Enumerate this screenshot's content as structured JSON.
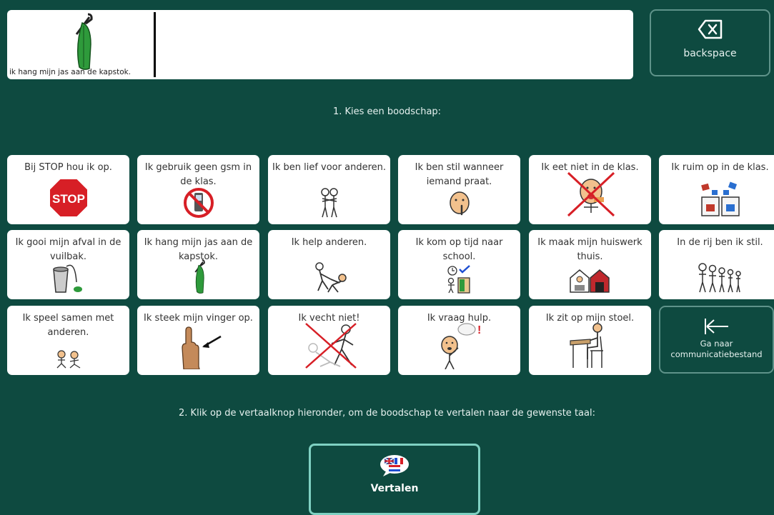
{
  "message": {
    "text": "ik hang mijn jas aan de kapstok."
  },
  "backspace": {
    "label": "backspace"
  },
  "instructions": {
    "step1": "1. Kies een boodschap:",
    "step2": "2. Klik op de vertaalknop hieronder, om de boodschap te vertalen naar de gewenste taal:"
  },
  "messages": [
    {
      "label": "Bij STOP hou ik op.",
      "icon": "stop-sign-icon"
    },
    {
      "label": "Ik gebruik geen gsm in de klas.",
      "icon": "no-phone-icon"
    },
    {
      "label": "Ik ben lief voor anderen.",
      "icon": "hug-icon"
    },
    {
      "label": "Ik ben stil wanneer iemand praat.",
      "icon": "quiet-face-icon"
    },
    {
      "label": "Ik eet niet in de klas.",
      "icon": "no-eating-icon"
    },
    {
      "label": "Ik ruim op in de klas.",
      "icon": "tidy-bins-icon"
    },
    {
      "label": "Ik gooi mijn afval in de vuilbak.",
      "icon": "trash-bin-icon"
    },
    {
      "label": "Ik hang mijn jas aan de kapstok.",
      "icon": "coat-hanger-icon"
    },
    {
      "label": "Ik help anderen.",
      "icon": "helping-icon"
    },
    {
      "label": "Ik kom op tijd naar school.",
      "icon": "on-time-icon"
    },
    {
      "label": "Ik maak mijn huiswerk thuis.",
      "icon": "homework-icon"
    },
    {
      "label": "In de rij ben ik stil.",
      "icon": "line-up-icon"
    },
    {
      "label": "Ik speel samen met anderen.",
      "icon": "play-together-icon"
    },
    {
      "label": "Ik steek mijn vinger op.",
      "icon": "raise-finger-icon"
    },
    {
      "label": "Ik vecht niet!",
      "icon": "no-fighting-icon"
    },
    {
      "label": "Ik vraag hulp.",
      "icon": "ask-help-icon"
    },
    {
      "label": "Ik zit op mijn stoel.",
      "icon": "sit-chair-icon"
    }
  ],
  "goto": {
    "line1": "Ga naar",
    "line2": "communicatiebestand"
  },
  "translate": {
    "label": "Vertalen"
  },
  "colors": {
    "background": "#0e4a40",
    "tile": "#ffffff",
    "button_border": "#5f938a",
    "translate_border": "#7fd1c2"
  }
}
